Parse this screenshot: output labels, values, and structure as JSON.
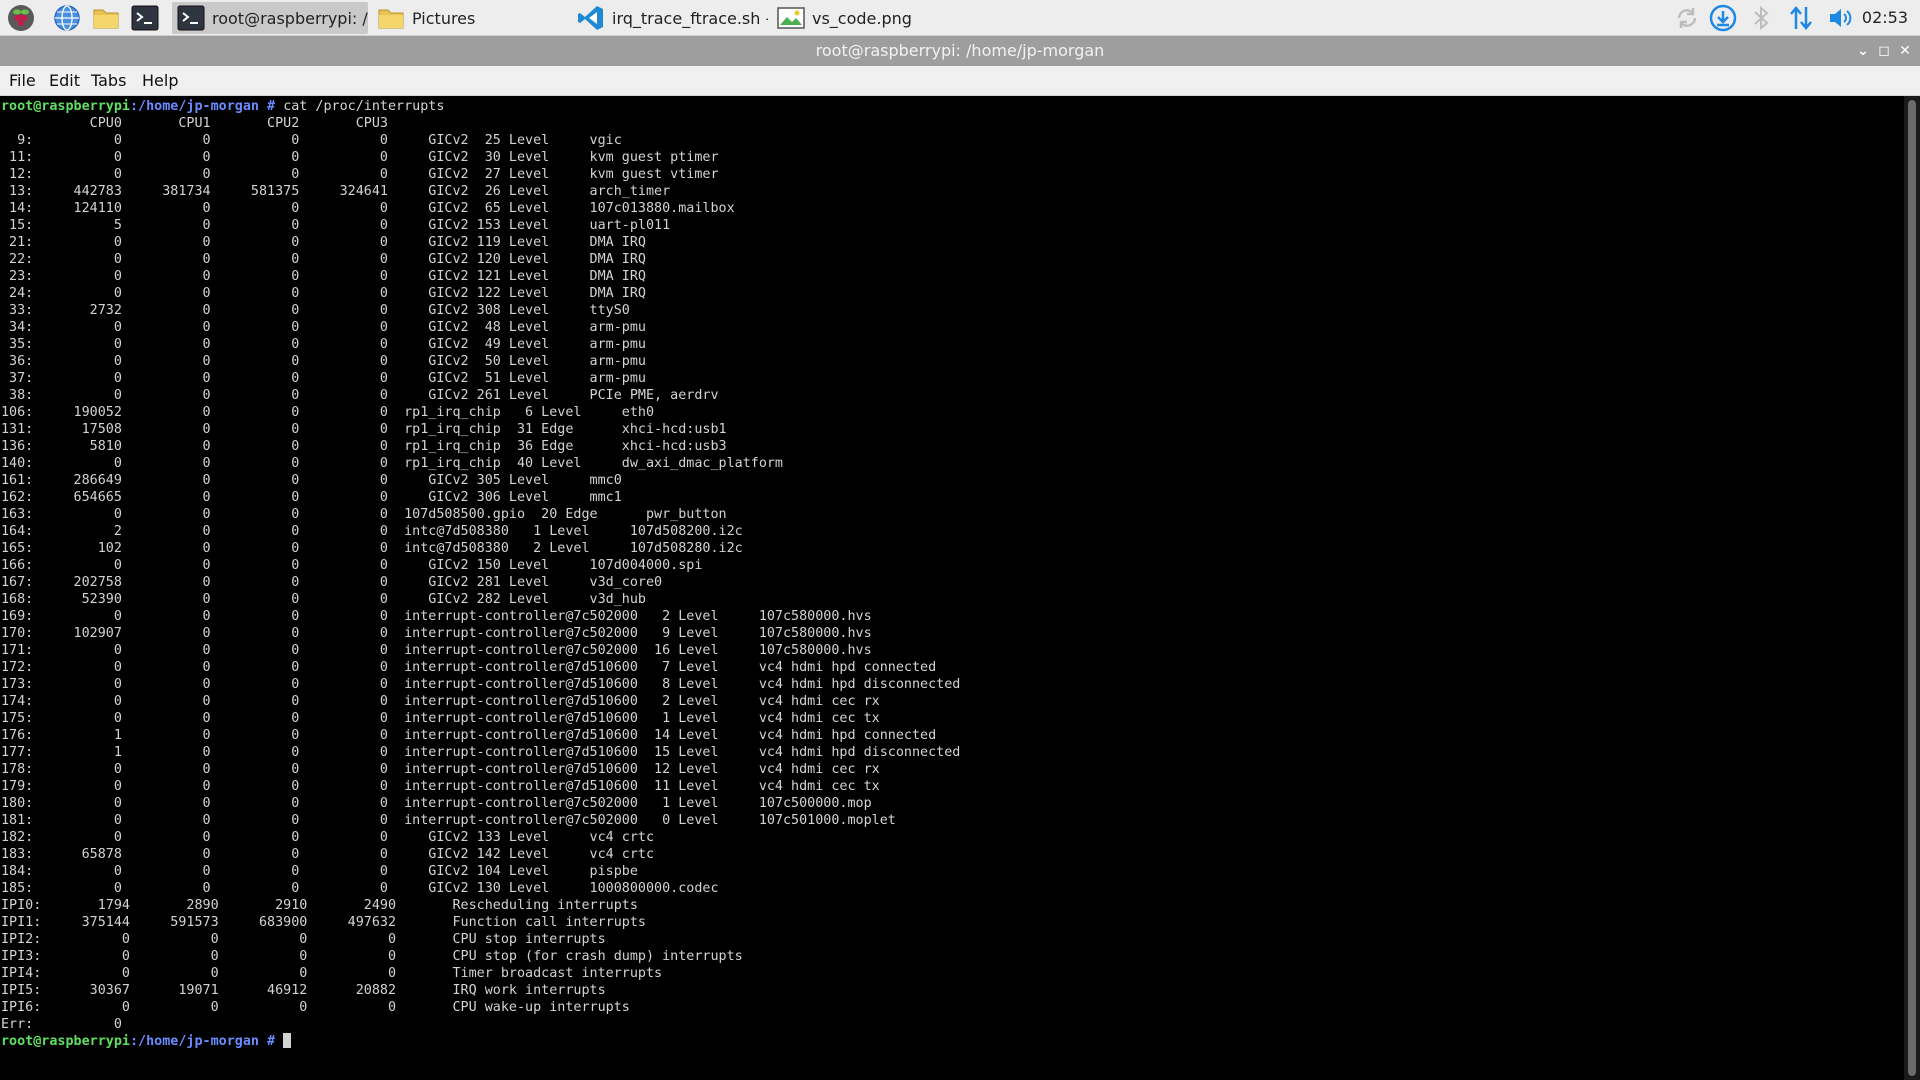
{
  "taskbar": {
    "tasks": [
      {
        "label": "root@raspberrypi: /h...",
        "icon": "terminal-icon",
        "active": true
      },
      {
        "label": "Pictures",
        "icon": "folder-icon",
        "active": false
      },
      {
        "label": "irq_trace_ftrace.sh - r...",
        "icon": "vscode-icon",
        "active": false
      },
      {
        "label": "vs_code.png",
        "icon": "image-viewer-icon",
        "active": false
      }
    ],
    "clock": "02:53",
    "colors": {
      "accent": "#1e88e5"
    }
  },
  "window": {
    "title": "root@raspberrypi: /home/jp-morgan",
    "buttons": {
      "minimize": "⌄",
      "maximize": "◻",
      "close": "✕"
    }
  },
  "menubar": {
    "items": [
      "File",
      "Edit",
      "Tabs",
      "Help"
    ]
  },
  "terminal": {
    "prompt_user": "root@raspberrypi",
    "prompt_path": ":/home/jp-morgan",
    "prompt_symbol": " # ",
    "command": "cat /proc/interrupts",
    "output": [
      "           CPU0       CPU1       CPU2       CPU3",
      "  9:          0          0          0          0     GICv2  25 Level     vgic",
      " 11:          0          0          0          0     GICv2  30 Level     kvm guest ptimer",
      " 12:          0          0          0          0     GICv2  27 Level     kvm guest vtimer",
      " 13:     442783     381734     581375     324641     GICv2  26 Level     arch_timer",
      " 14:     124110          0          0          0     GICv2  65 Level     107c013880.mailbox",
      " 15:          5          0          0          0     GICv2 153 Level     uart-pl011",
      " 21:          0          0          0          0     GICv2 119 Level     DMA IRQ",
      " 22:          0          0          0          0     GICv2 120 Level     DMA IRQ",
      " 23:          0          0          0          0     GICv2 121 Level     DMA IRQ",
      " 24:          0          0          0          0     GICv2 122 Level     DMA IRQ",
      " 33:       2732          0          0          0     GICv2 308 Level     ttyS0",
      " 34:          0          0          0          0     GICv2  48 Level     arm-pmu",
      " 35:          0          0          0          0     GICv2  49 Level     arm-pmu",
      " 36:          0          0          0          0     GICv2  50 Level     arm-pmu",
      " 37:          0          0          0          0     GICv2  51 Level     arm-pmu",
      " 38:          0          0          0          0     GICv2 261 Level     PCIe PME, aerdrv",
      "106:     190052          0          0          0  rp1_irq_chip   6 Level     eth0",
      "131:      17508          0          0          0  rp1_irq_chip  31 Edge      xhci-hcd:usb1",
      "136:       5810          0          0          0  rp1_irq_chip  36 Edge      xhci-hcd:usb3",
      "140:          0          0          0          0  rp1_irq_chip  40 Level     dw_axi_dmac_platform",
      "161:     286649          0          0          0     GICv2 305 Level     mmc0",
      "162:     654665          0          0          0     GICv2 306 Level     mmc1",
      "163:          0          0          0          0  107d508500.gpio  20 Edge      pwr_button",
      "164:          2          0          0          0  intc@7d508380   1 Level     107d508200.i2c",
      "165:        102          0          0          0  intc@7d508380   2 Level     107d508280.i2c",
      "166:          0          0          0          0     GICv2 150 Level     107d004000.spi",
      "167:     202758          0          0          0     GICv2 281 Level     v3d_core0",
      "168:      52390          0          0          0     GICv2 282 Level     v3d_hub",
      "169:          0          0          0          0  interrupt-controller@7c502000   2 Level     107c580000.hvs",
      "170:     102907          0          0          0  interrupt-controller@7c502000   9 Level     107c580000.hvs",
      "171:          0          0          0          0  interrupt-controller@7c502000  16 Level     107c580000.hvs",
      "172:          0          0          0          0  interrupt-controller@7d510600   7 Level     vc4 hdmi hpd connected",
      "173:          0          0          0          0  interrupt-controller@7d510600   8 Level     vc4 hdmi hpd disconnected",
      "174:          0          0          0          0  interrupt-controller@7d510600   2 Level     vc4 hdmi cec rx",
      "175:          0          0          0          0  interrupt-controller@7d510600   1 Level     vc4 hdmi cec tx",
      "176:          1          0          0          0  interrupt-controller@7d510600  14 Level     vc4 hdmi hpd connected",
      "177:          1          0          0          0  interrupt-controller@7d510600  15 Level     vc4 hdmi hpd disconnected",
      "178:          0          0          0          0  interrupt-controller@7d510600  12 Level     vc4 hdmi cec rx",
      "179:          0          0          0          0  interrupt-controller@7d510600  11 Level     vc4 hdmi cec tx",
      "180:          0          0          0          0  interrupt-controller@7c502000   1 Level     107c500000.mop",
      "181:          0          0          0          0  interrupt-controller@7c502000   0 Level     107c501000.moplet",
      "182:          0          0          0          0     GICv2 133 Level     vc4 crtc",
      "183:      65878          0          0          0     GICv2 142 Level     vc4 crtc",
      "184:          0          0          0          0     GICv2 104 Level     pispbe",
      "185:          0          0          0          0     GICv2 130 Level     1000800000.codec",
      "IPI0:       1794       2890       2910       2490       Rescheduling interrupts",
      "IPI1:     375144     591573     683900     497632       Function call interrupts",
      "IPI2:          0          0          0          0       CPU stop interrupts",
      "IPI3:          0          0          0          0       CPU stop (for crash dump) interrupts",
      "IPI4:          0          0          0          0       Timer broadcast interrupts",
      "IPI5:      30367      19071      46912      20882       IRQ work interrupts",
      "IPI6:          0          0          0          0       CPU wake-up interrupts",
      "Err:          0"
    ]
  }
}
